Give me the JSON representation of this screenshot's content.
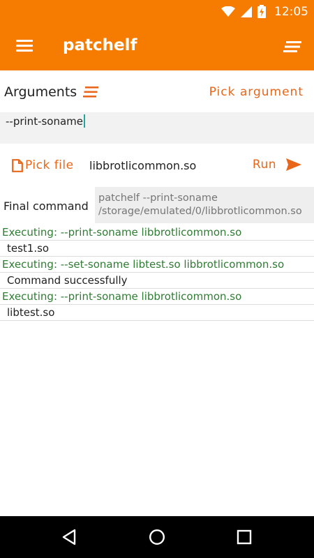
{
  "status_bar": {
    "time": "12:05",
    "icons": [
      "wifi-icon",
      "signal-icon",
      "battery-charging-icon"
    ]
  },
  "app_bar": {
    "title": "patchelf",
    "menu_icon": "hamburger-menu-icon",
    "action_icon": "sort-icon"
  },
  "arguments": {
    "label": "Arguments",
    "pick_label": "Pick argument",
    "value": "--print-soname"
  },
  "file": {
    "pick_label": "Pick file",
    "name": "libbrotlicommon.so",
    "run_label": "Run"
  },
  "final_command": {
    "label": "Final command",
    "value": "patchelf --print-soname /storage/emulated/0/libbrotlicommon.so"
  },
  "log": [
    {
      "type": "exec",
      "text": "Executing:  --print-soname libbrotlicommon.so"
    },
    {
      "type": "output",
      "text": "test1.so"
    },
    {
      "type": "exec",
      "text": "Executing:  --set-soname libtest.so libbrotlicommon.so"
    },
    {
      "type": "output",
      "text": "Command successfully"
    },
    {
      "type": "exec",
      "text": "Executing:  --print-soname libbrotlicommon.so"
    },
    {
      "type": "output",
      "text": "libtest.so"
    }
  ],
  "colors": {
    "primary": "#F57C00",
    "accent": "#E8671A",
    "exec_text": "#2E7D32"
  },
  "nav_bar": {
    "icons": [
      "back-icon",
      "home-icon",
      "recents-icon"
    ]
  }
}
